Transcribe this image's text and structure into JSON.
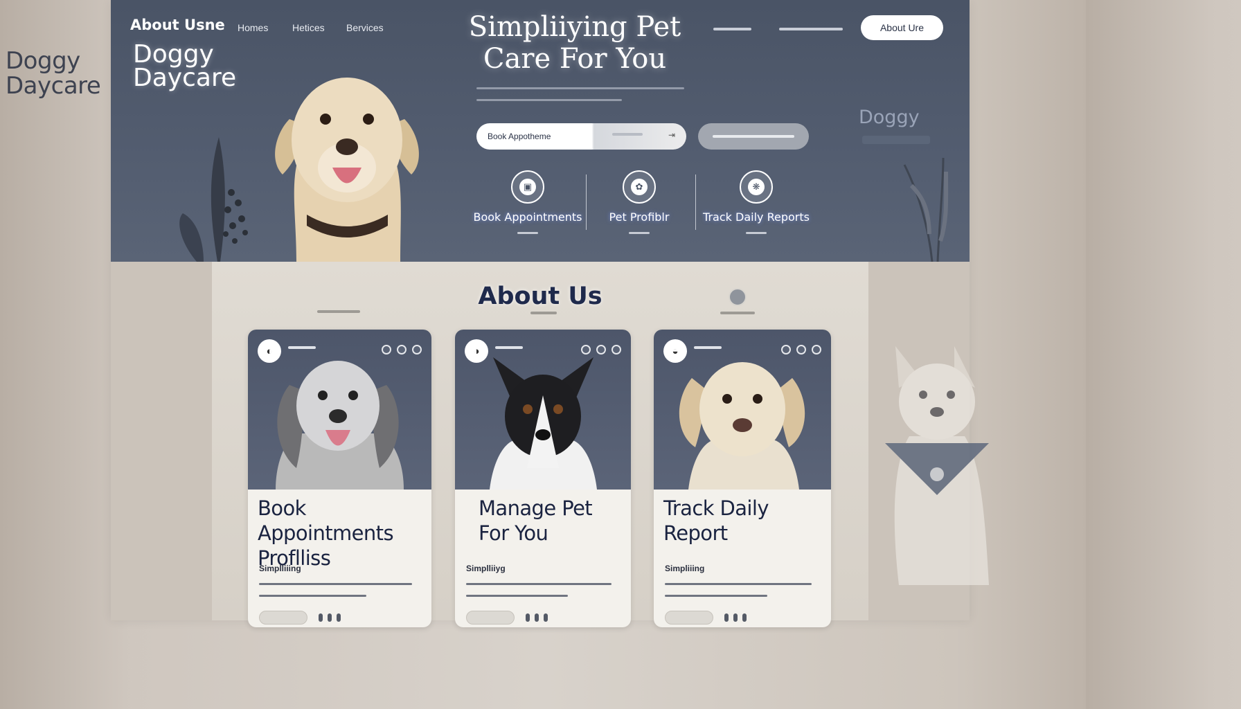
{
  "side_brand": {
    "line1": "Doggy",
    "line2": "Daycare"
  },
  "header": {
    "brand_top": "About Usne",
    "nav": [
      "Homes",
      "Hetices",
      "Bervices"
    ],
    "brand_line1": "Doggy",
    "brand_line2": "Daycare",
    "title_line1": "Simpliiying Pet",
    "title_line2": "Care For You",
    "about_button": "About Ure"
  },
  "hero": {
    "book_pill_label": "Book Appotheme",
    "book_pill_icon": "arrow-icon",
    "features": [
      {
        "label": "Book Appointments",
        "icon": "calendar-paw-icon"
      },
      {
        "label": "Pet Profiblr",
        "icon": "paw-icon"
      },
      {
        "label": "Track Daily Reports",
        "icon": "report-icon"
      }
    ],
    "ghost_brand": "Doggy"
  },
  "about": {
    "title": "About Us",
    "cards": [
      {
        "title_line1": "Book Appointments",
        "title_line2": "Proflliss",
        "lead": "Simplliiing",
        "photo": "spaniel-dog-photo"
      },
      {
        "title_line1": "Manage Pet",
        "title_line2": "For You",
        "lead": "Simplliiyg",
        "photo": "shepherd-dog-photo"
      },
      {
        "title_line1": "Track Daily",
        "title_line2": "Report",
        "lead": "Simpliiing",
        "photo": "retriever-dog-photo"
      }
    ]
  },
  "colors": {
    "hero": "#4a5466",
    "accent": "#1f2a4c",
    "background": "#d8d2cb"
  }
}
